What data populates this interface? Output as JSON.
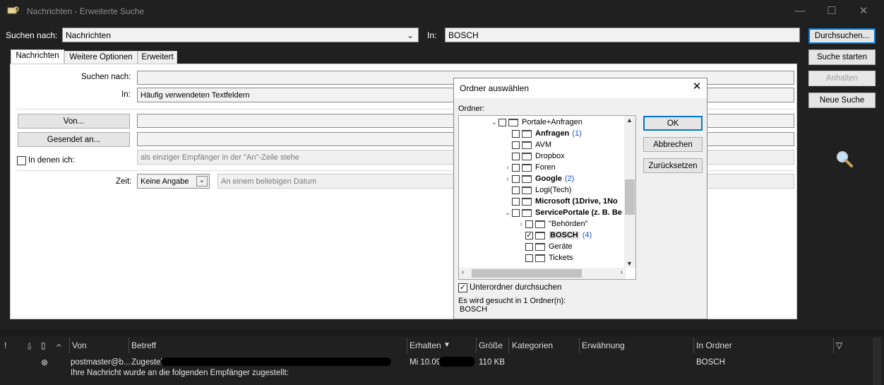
{
  "window": {
    "title": "Nachrichten - Erweiterte Suche"
  },
  "top": {
    "search_for_label": "Suchen nach:",
    "search_for_value": "Nachrichten",
    "in_label": "In:",
    "in_value": "BOSCH"
  },
  "buttons": {
    "browse": "Durchsuchen...",
    "start": "Suche starten",
    "stop": "Anhalten",
    "new": "Neue Suche"
  },
  "tabs": [
    {
      "label": "Nachrichten",
      "active": true
    },
    {
      "label": "Weitere Optionen",
      "active": false
    },
    {
      "label": "Erweitert",
      "active": false
    }
  ],
  "form": {
    "search_label": "Suchen nach:",
    "search_value": "",
    "in_label": "In:",
    "in_value": "Häufig verwendeten Textfeldern",
    "from_button": "Von...",
    "from_value": "",
    "sent_to_button": "Gesendet an...",
    "sent_to_value": "",
    "where_i_label": "In denen ich:",
    "where_i_value": "als einziger Empfänger in der \"An\"-Zeile stehe",
    "time_label": "Zeit:",
    "time_value": "Keine Angabe",
    "date_value": "An einem beliebigen Datum"
  },
  "dialog": {
    "title": "Ordner auswählen",
    "folder_label": "Ordner:",
    "ok": "OK",
    "cancel": "Abbrechen",
    "reset": "Zurücksetzen",
    "subfolders_label": "Unterordner durchsuchen",
    "subfolders_checked": true,
    "status_line1": "Es wird gesucht in 1 Ordner(n):",
    "status_line2": "BOSCH",
    "tree": [
      {
        "name": "Portale+Anfragen",
        "level": 0,
        "expander": "⌄",
        "checked": false,
        "bold": false,
        "count": ""
      },
      {
        "name": "Anfragen",
        "level": 1,
        "expander": "",
        "checked": false,
        "bold": true,
        "count": "(1)"
      },
      {
        "name": "AVM",
        "level": 1,
        "expander": "",
        "checked": false,
        "bold": false,
        "count": ""
      },
      {
        "name": "Dropbox",
        "level": 1,
        "expander": "",
        "checked": false,
        "bold": false,
        "count": ""
      },
      {
        "name": "Foren",
        "level": 1,
        "expander": "›",
        "checked": false,
        "bold": false,
        "count": ""
      },
      {
        "name": "Google",
        "level": 1,
        "expander": "›",
        "checked": false,
        "bold": true,
        "count": "(2)"
      },
      {
        "name": "Logi(Tech)",
        "level": 1,
        "expander": "",
        "checked": false,
        "bold": false,
        "count": ""
      },
      {
        "name": "Microsoft (1Drive, 1No",
        "level": 1,
        "expander": "",
        "checked": false,
        "bold": true,
        "count": ""
      },
      {
        "name": "ServicePortale (z. B. Be",
        "level": 1,
        "expander": "⌄",
        "checked": false,
        "bold": true,
        "count": ""
      },
      {
        "name": "\"Behörden\"",
        "level": 2,
        "expander": "›",
        "checked": false,
        "bold": false,
        "count": ""
      },
      {
        "name": "BOSCH",
        "level": 2,
        "expander": "",
        "checked": true,
        "bold": true,
        "count": "(4)"
      },
      {
        "name": "Geräte",
        "level": 2,
        "expander": "",
        "checked": false,
        "bold": false,
        "count": ""
      },
      {
        "name": "Tickets",
        "level": 2,
        "expander": "",
        "checked": false,
        "bold": false,
        "count": ""
      }
    ]
  },
  "results": {
    "columns": [
      "!",
      "Von",
      "Betreff",
      "Erhalten",
      "Größe",
      "Kategorien",
      "Erwähnung",
      "In Ordner"
    ],
    "row": {
      "from": "postmaster@b...",
      "subject": "Zugestellt:",
      "preview": "Ihre Nachricht wurde an die folgenden Empfänger zugestellt:",
      "received": "Mi 10.09.",
      "size": "110 KB",
      "folder": "BOSCH"
    }
  },
  "colors": {
    "accent": "#0078d7",
    "count_blue": "#1b4fd6",
    "dark_bg": "#202020"
  }
}
